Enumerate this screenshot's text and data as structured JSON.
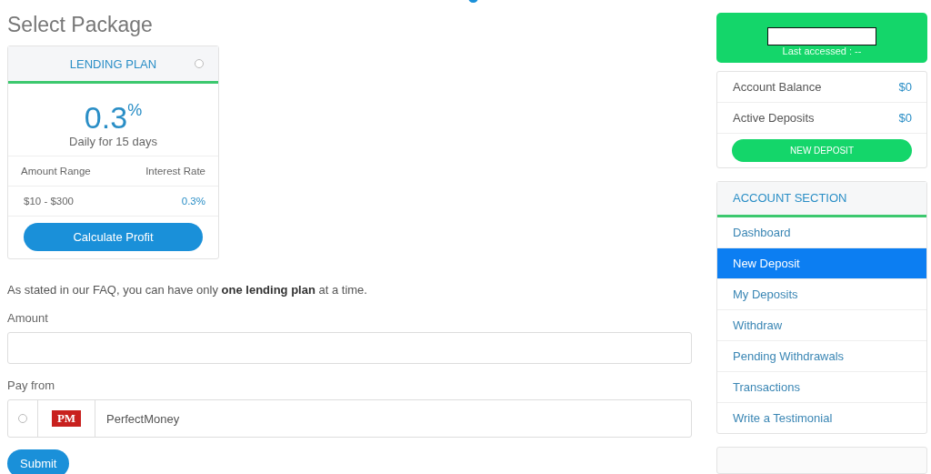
{
  "page_title": "Select Package",
  "plan": {
    "name": "LENDING PLAN",
    "selected": false,
    "rate": "0.3",
    "rate_unit": "%",
    "period": "Daily for 15 days",
    "columns": [
      "Amount Range",
      "Interest Rate"
    ],
    "row": [
      "$10 - $300",
      "0.3%"
    ],
    "button": "Calculate Profit"
  },
  "notice": "As stated in our FAQ, you can have only **one lending plan** at a time.",
  "amount": {
    "label": "Amount"
  },
  "pay_from": {
    "label": "Pay from",
    "options": [
      {
        "name": "PerfectMoney",
        "logo": "PM",
        "selected": false
      }
    ]
  },
  "submit": "Submit",
  "account": {
    "last_accessed": "Last accessed : --",
    "stats": [
      {
        "label": "Account Balance",
        "value": "$0"
      },
      {
        "label": "Active Deposits",
        "value": "$0"
      }
    ],
    "button": "NEW DEPOSIT"
  },
  "menu": {
    "title": "ACCOUNT SECTION",
    "items": [
      {
        "label": "Dashboard",
        "selected": false
      },
      {
        "label": "New Deposit",
        "selected": true
      },
      {
        "label": "My Deposits",
        "selected": false
      },
      {
        "label": "Withdraw",
        "selected": false
      },
      {
        "label": "Pending Withdrawals",
        "selected": false
      },
      {
        "label": "Transactions",
        "selected": false
      },
      {
        "label": "Write a Testimonial",
        "selected": false
      }
    ]
  }
}
